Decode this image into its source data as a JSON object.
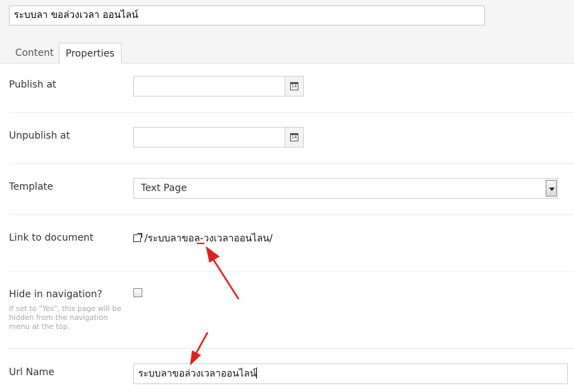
{
  "page": {
    "title_value": "ระบบลา ขอล่วงเวลา ออนไลน์"
  },
  "tabs": [
    {
      "label": "Content",
      "active": false
    },
    {
      "label": "Properties",
      "active": true
    }
  ],
  "properties": {
    "publish_at": {
      "label": "Publish at",
      "value": "",
      "calendar_icon_text": "14"
    },
    "unpublish_at": {
      "label": "Unpublish at",
      "value": "",
      "calendar_icon_text": "14"
    },
    "template": {
      "label": "Template",
      "selected": "Text Page"
    },
    "link_to_document": {
      "label": "Link to document",
      "value": "/ระบบลาขอล-วงเวลาออนไลน/"
    },
    "hide_in_navigation": {
      "label": "Hide in navigation?",
      "help": "If set to \"Yes\", this page will be hidden from the navigation menu at the top.",
      "checked": false
    },
    "url_name": {
      "label": "Url Name",
      "value": "ระบบลาขอล่วงเวลาออนไลน์"
    }
  },
  "annotations": {
    "arrow_color": "#e0201b"
  },
  "icons": {
    "calendar": "calendar-icon",
    "external_link": "external-link-icon",
    "dropdown": "chevron-down-icon"
  }
}
